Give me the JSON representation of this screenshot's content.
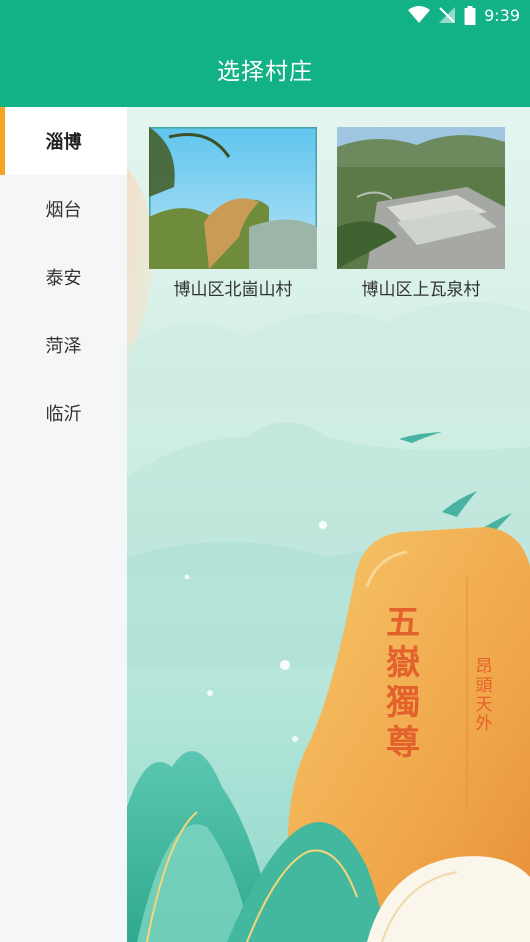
{
  "status_bar": {
    "time": "9:39",
    "icons": [
      "wifi-icon",
      "signal-icon",
      "battery-icon"
    ]
  },
  "header": {
    "title": "选择村庄"
  },
  "sidebar": {
    "items": [
      {
        "label": "淄博",
        "active": true
      },
      {
        "label": "烟台",
        "active": false
      },
      {
        "label": "泰安",
        "active": false
      },
      {
        "label": "菏泽",
        "active": false
      },
      {
        "label": "临沂",
        "active": false
      }
    ]
  },
  "main": {
    "villages": [
      {
        "name": "博山区北崮山村"
      },
      {
        "name": "博山区上瓦泉村"
      }
    ],
    "poster": {
      "main_text": [
        "五",
        "嶽",
        "獨",
        "尊"
      ],
      "side_text": [
        "昂",
        "頭",
        "天",
        "外"
      ]
    }
  },
  "colors": {
    "primary": "#12b286",
    "accent": "#f7a324",
    "sidebar_bg": "#f5f6f8"
  }
}
